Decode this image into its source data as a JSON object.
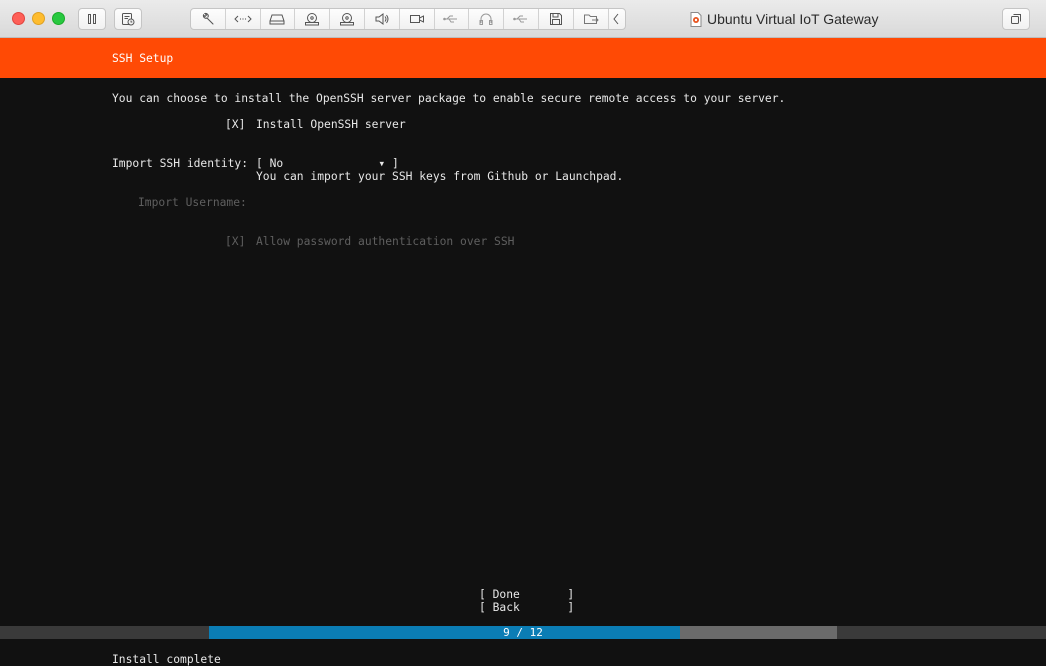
{
  "window": {
    "title": "Ubuntu Virtual IoT Gateway"
  },
  "toolbar": {
    "icons": [
      "pause-icon",
      "snapshot-icon",
      "wrench-icon",
      "code-icon",
      "disk-icon",
      "optical-drive-icon",
      "optical-drive-icon",
      "speaker-icon",
      "camera-icon",
      "usb-icon",
      "headphones-icon",
      "usb-icon",
      "floppy-icon",
      "shared-folder-icon",
      "chevron-left-icon",
      "vm-document-icon",
      "fullscreen-icon"
    ]
  },
  "installer": {
    "header_title": "SSH Setup",
    "description": "You can choose to install the OpenSSH server package to enable secure remote access to your server.",
    "install_openssh": {
      "checkbox": "[X]",
      "label": "Install OpenSSH server"
    },
    "import_identity": {
      "label": "Import SSH identity:",
      "value": "[ No              ▾ ]",
      "help": "You can import your SSH keys from Github or Launchpad."
    },
    "import_username": {
      "label": "Import Username:"
    },
    "password_auth": {
      "checkbox": "[X]",
      "label": "Allow password authentication over SSH"
    },
    "buttons": {
      "done": "[ Done       ]",
      "back": "[ Back       ]"
    },
    "progress": {
      "label": "9 / 12",
      "current": 9,
      "total": 12
    },
    "status": "Install complete"
  },
  "colors": {
    "header": "#ff4a05",
    "progress_fill": "#0b7db5",
    "progress_track": "#6b6b6b",
    "background": "#111111"
  }
}
